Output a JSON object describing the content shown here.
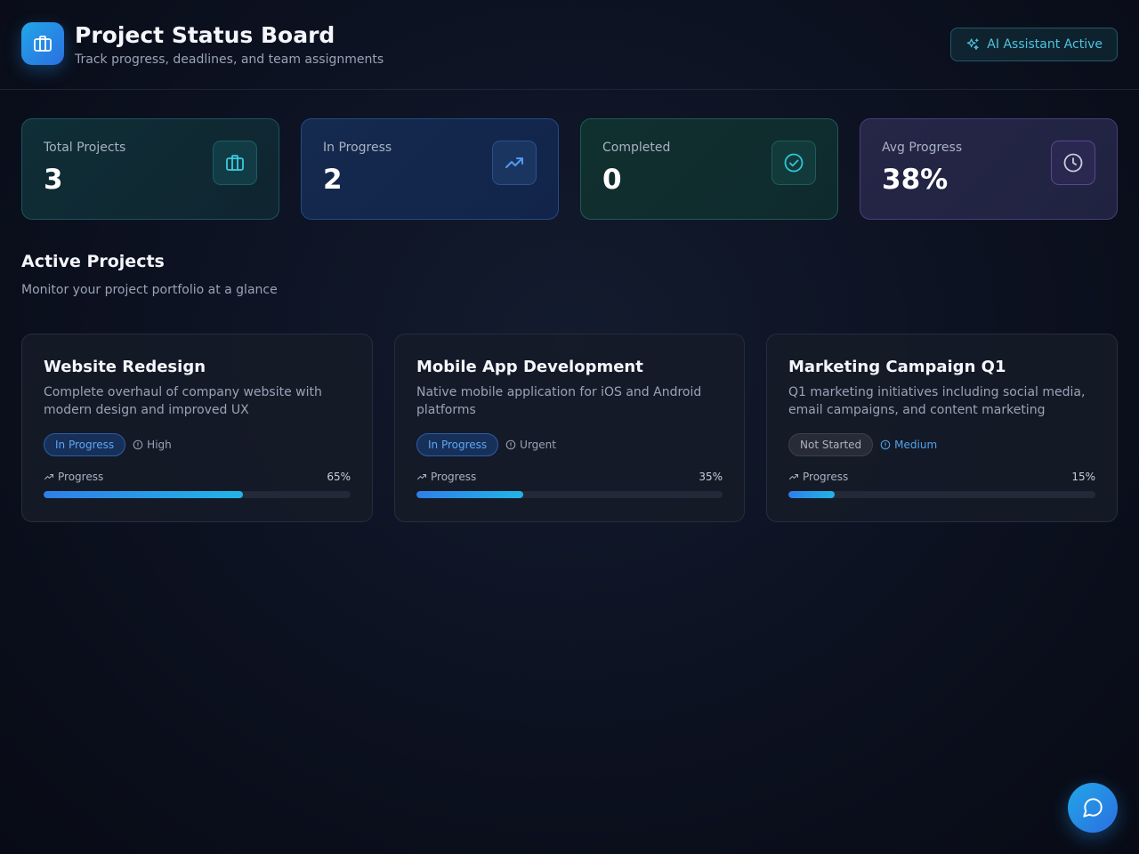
{
  "header": {
    "title": "Project Status Board",
    "subtitle": "Track progress, deadlines, and team assignments",
    "ai_label": "AI Assistant Active"
  },
  "stats": [
    {
      "label": "Total Projects",
      "value": "3",
      "icon": "briefcase-icon"
    },
    {
      "label": "In Progress",
      "value": "2",
      "icon": "trending-up-icon"
    },
    {
      "label": "Completed",
      "value": "0",
      "icon": "check-circle-icon"
    },
    {
      "label": "Avg Progress",
      "value": "38%",
      "icon": "clock-icon"
    }
  ],
  "section": {
    "title": "Active Projects",
    "subtitle": "Monitor your project portfolio at a glance"
  },
  "projects": [
    {
      "name": "Website Redesign",
      "description": "Complete overhaul of company website with modern design and improved UX",
      "status": "In Progress",
      "priority": "High",
      "progress_label": "Progress",
      "progress_text": "65%",
      "progress": 0.65
    },
    {
      "name": "Mobile App Development",
      "description": "Native mobile application for iOS and Android platforms",
      "status": "In Progress",
      "priority": "Urgent",
      "progress_label": "Progress",
      "progress_text": "35%",
      "progress": 0.35
    },
    {
      "name": "Marketing Campaign Q1",
      "description": "Q1 marketing initiatives including social media, email campaigns, and content marketing",
      "status": "Not Started",
      "priority": "Medium",
      "progress_label": "Progress",
      "progress_text": "15%",
      "progress": 0.15
    }
  ],
  "colors": {
    "accent": "#22a6e8",
    "in_progress": "#5ea6f0",
    "ai": "#4fc3df"
  }
}
